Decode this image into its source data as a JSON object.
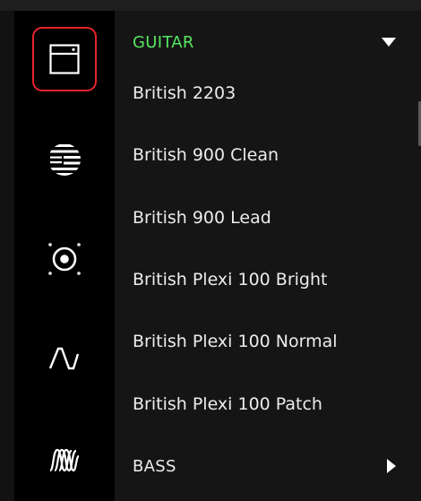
{
  "sidebar": {
    "categories": [
      {
        "icon": "amp-head-icon",
        "selected": true
      },
      {
        "icon": "preamp-icon",
        "selected": false
      },
      {
        "icon": "speaker-cabinet-icon",
        "selected": false
      },
      {
        "icon": "waveform-icon",
        "selected": false
      },
      {
        "icon": "modulation-waves-icon",
        "selected": false
      }
    ]
  },
  "browser": {
    "sections": [
      {
        "label": "GUITAR",
        "expanded": true,
        "color": "#57e65f"
      },
      {
        "label": "BASS",
        "expanded": false,
        "color": "#ececec"
      }
    ],
    "guitar_items": [
      "British 2203",
      "British 900 Clean",
      "British 900 Lead",
      "British Plexi 100 Bright",
      "British Plexi 100 Normal",
      "British Plexi 100 Patch"
    ]
  },
  "colors": {
    "accent_green": "#57e65f",
    "selection_red": "#e5252c",
    "sidebar_bg": "#000000",
    "panel_bg": "#151515"
  }
}
